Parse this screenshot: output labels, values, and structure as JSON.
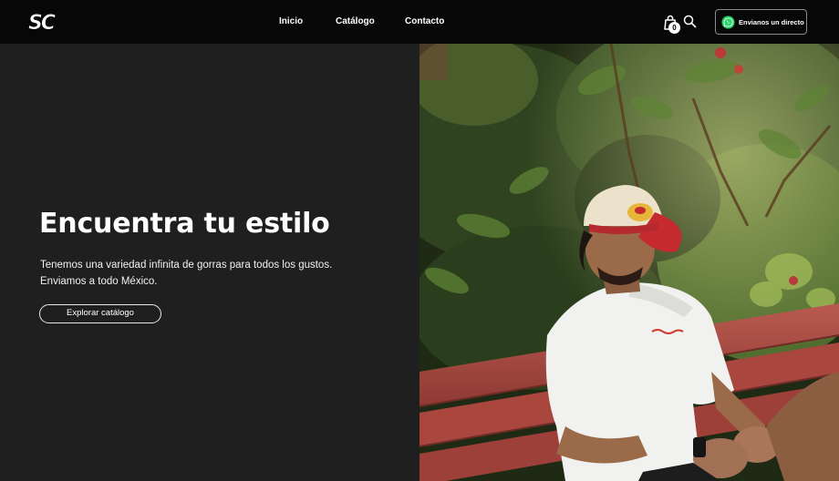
{
  "brand": {
    "logo_text": "SC"
  },
  "nav": {
    "items": [
      "Inicio",
      "Catálogo",
      "Contacto"
    ]
  },
  "header": {
    "cart_count": "0",
    "whatsapp_label": "Envianos un directo"
  },
  "hero": {
    "title": "Encuentra tu estilo",
    "subtitle_lines": [
      "Tenemos una variedad infinita de gorras para todos los gustos.",
      "Enviamos a todo México."
    ],
    "cta_label": "Explorar catálogo"
  },
  "colors": {
    "header_bg": "#070707",
    "hero_bg": "#1f1f1f",
    "whatsapp_green": "#25D366",
    "bench_red": "#a9473f",
    "cap_red": "#c52a2f"
  },
  "icons": [
    "cart-icon",
    "search-icon",
    "whatsapp-icon"
  ]
}
